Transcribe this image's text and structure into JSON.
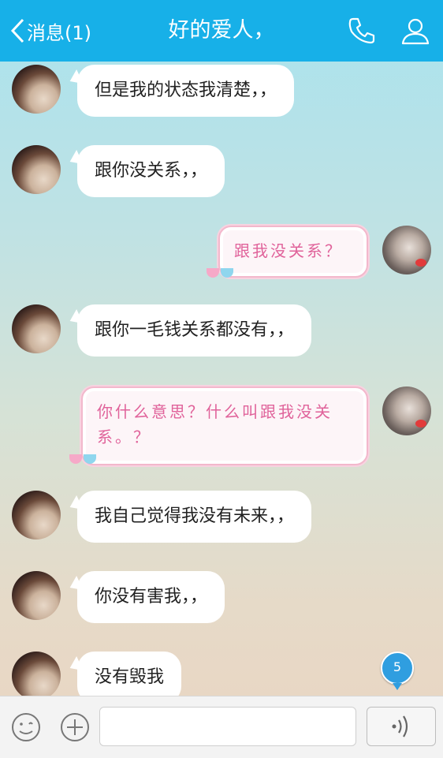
{
  "header": {
    "back_label": "消息(1)",
    "title": "好的爱人，"
  },
  "messages": [
    {
      "sender": "her",
      "text": "但是我的状态我清楚，，"
    },
    {
      "sender": "her",
      "text": "跟你没关系，，"
    },
    {
      "sender": "me",
      "text": "跟我没关系？"
    },
    {
      "sender": "her",
      "text": "跟你一毛钱关系都没有，，"
    },
    {
      "sender": "me",
      "text_line1": "你什么意思？什么叫跟我没关",
      "text_line2": "系。？"
    },
    {
      "sender": "her",
      "text": "我自己觉得我没有未来，，"
    },
    {
      "sender": "her",
      "text": "你没有害我，，"
    },
    {
      "sender": "her",
      "text": "没有毁我"
    }
  ],
  "unread_badge": "5",
  "input": {
    "value": "",
    "placeholder": ""
  },
  "colors": {
    "header": "#17b0e8",
    "pink_text": "#e0629a",
    "badge": "#2f9ee0"
  },
  "icons": [
    "back-chevron-icon",
    "phone-icon",
    "person-icon",
    "emoji-icon",
    "plus-icon",
    "voice-icon"
  ]
}
